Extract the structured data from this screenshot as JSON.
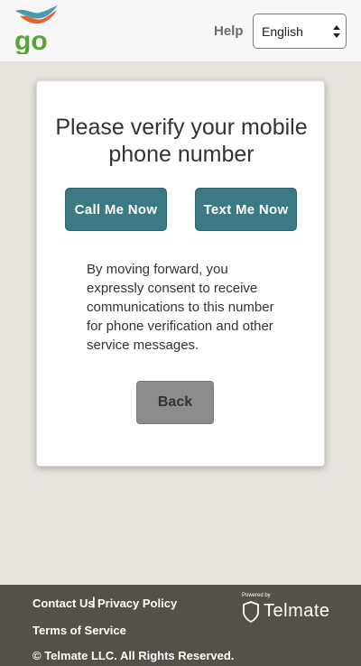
{
  "header": {
    "logo_text": "go",
    "help_label": "Help",
    "language": {
      "selected": "English"
    }
  },
  "card": {
    "title": "Please verify your mobile phone number",
    "call_button": "Call Me Now",
    "text_button": "Text Me Now",
    "consent_text": "By moving forward, you expressly consent to receive communications to this number for phone verification and other service messages.",
    "back_button": "Back"
  },
  "footer": {
    "contact_us": "Contact Us",
    "separator": "|",
    "privacy_policy": "Privacy Policy",
    "terms_of_service": "Terms of Service",
    "copyright": "© Telmate LLC. All Rights Reserved.",
    "powered_by": "Powered by",
    "brand": "Telmate"
  },
  "colors": {
    "page_background": "#e7e3dd",
    "primary_button": "#3c7a83",
    "back_button": "#8c8c8c",
    "footer_background": "#545149",
    "logo_green": "#5aa33a",
    "logo_orange": "#e8622c",
    "logo_teal": "#4a9bb0"
  },
  "icons": {
    "logo": "go-logo-bird-icon",
    "language_arrows": "select-arrows-icon",
    "telmate": "shield-icon"
  }
}
